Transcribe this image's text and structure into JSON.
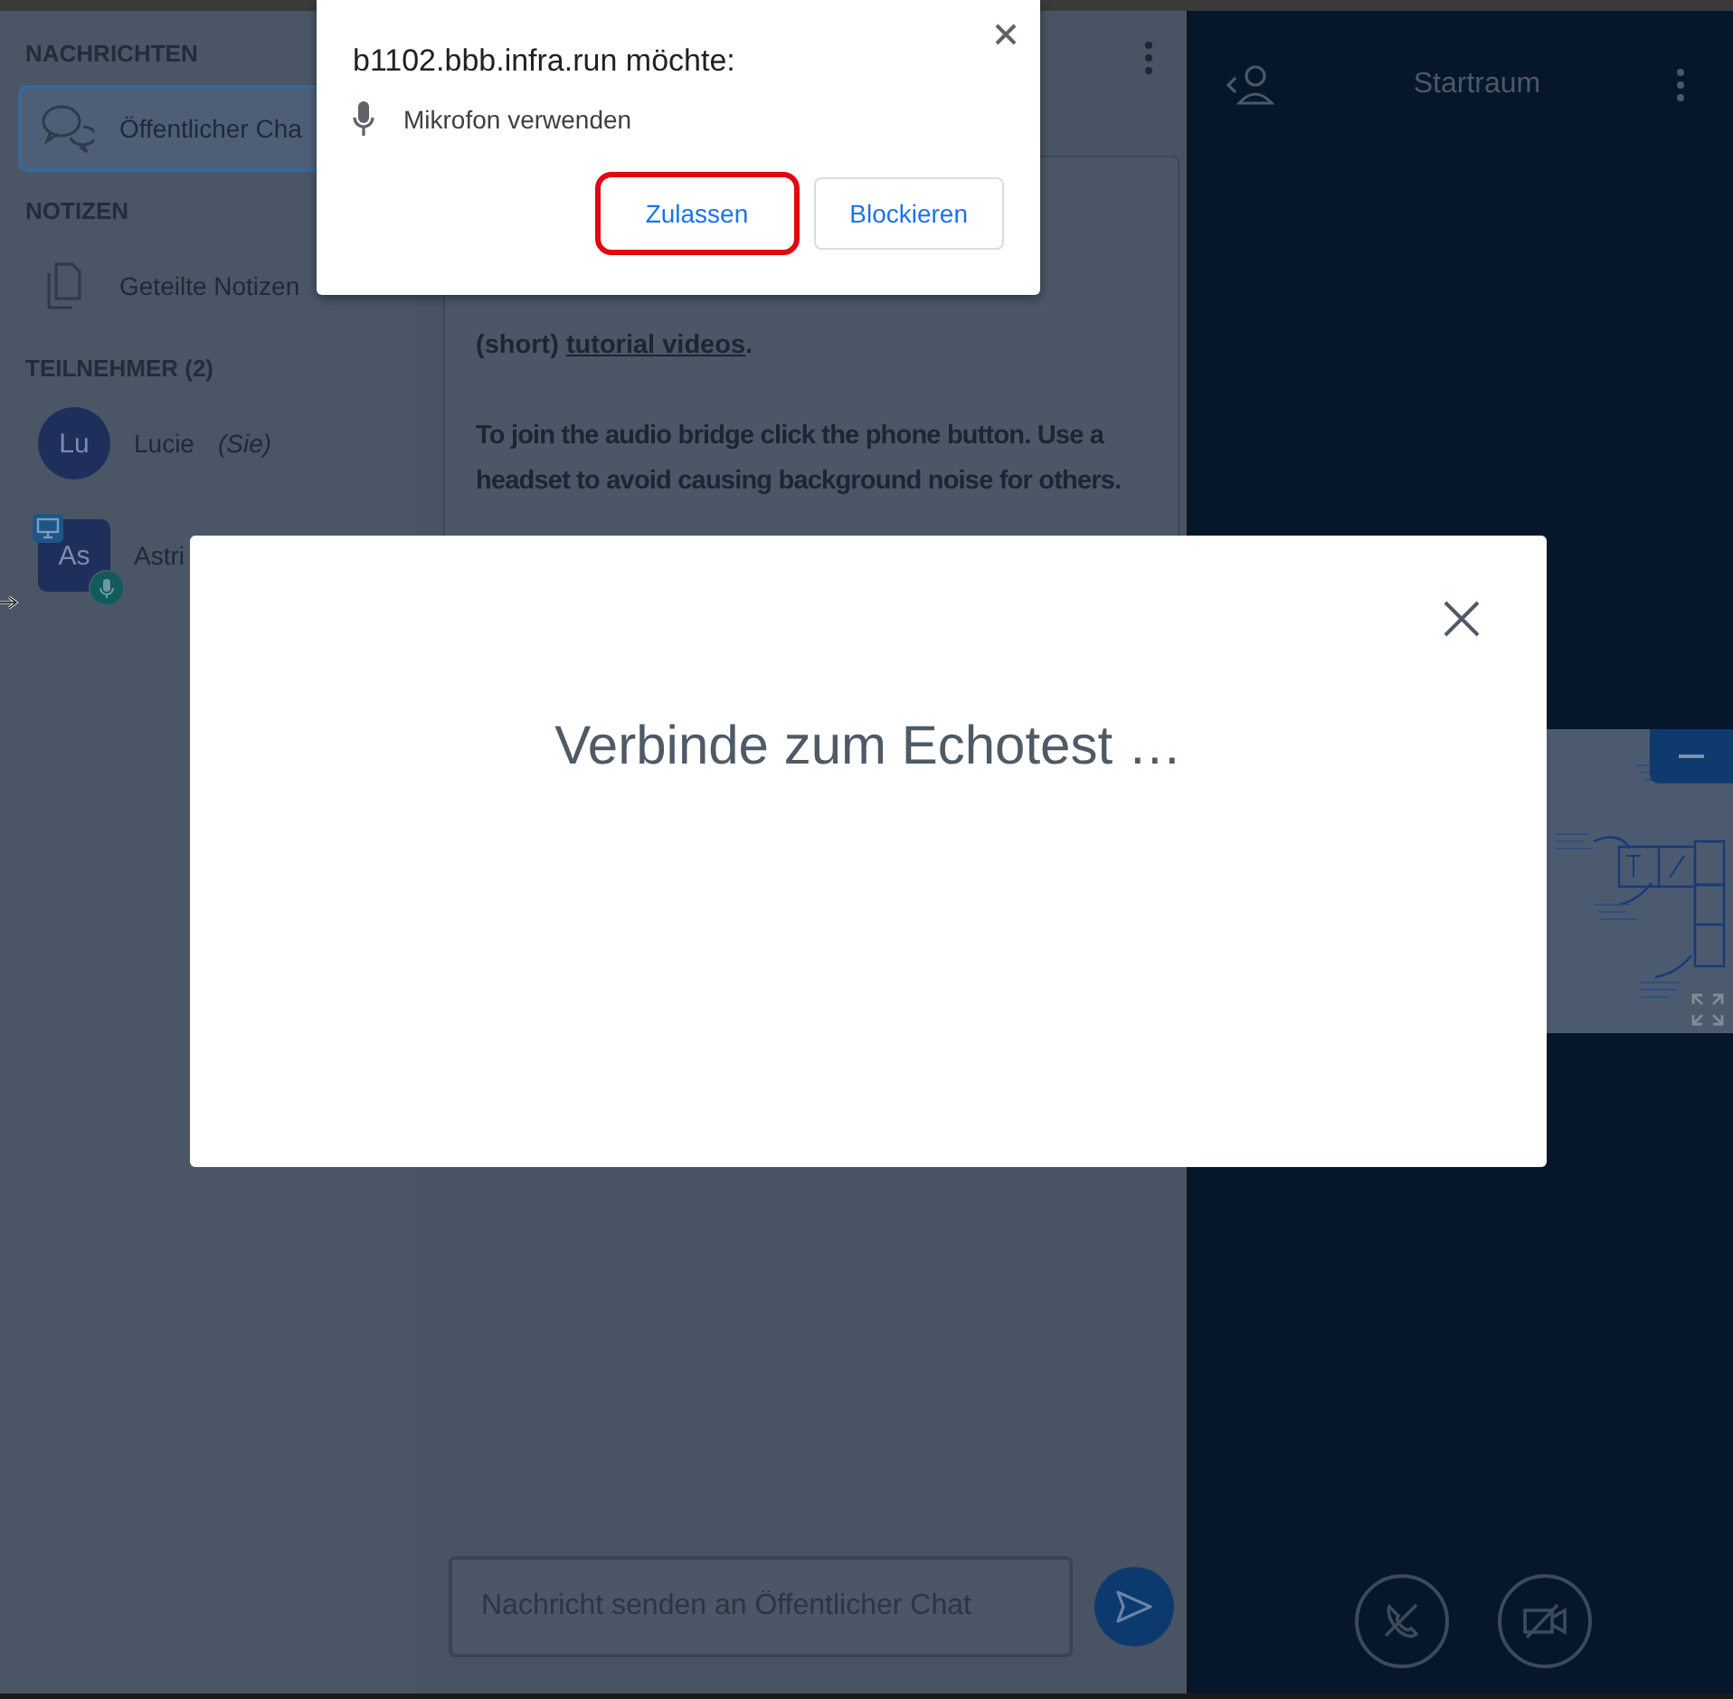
{
  "popup": {
    "origin": "b1102.bbb.infra.run möchte:",
    "permission": "Mikrofon verwenden",
    "buttons": [
      {
        "label": "Zulassen",
        "highlighted": true
      },
      {
        "label": "Blockieren",
        "highlighted": false
      }
    ]
  },
  "sidebar": {
    "sections": [
      {
        "title": "NACHRICHTEN",
        "items": [
          {
            "kind": "chat",
            "label": "Öffentlicher Cha",
            "selected": true
          }
        ]
      },
      {
        "title": "NOTIZEN",
        "items": [
          {
            "kind": "notes",
            "label": "Geteilte Notizen",
            "selected": false
          }
        ]
      }
    ],
    "participants": {
      "title": "TEILNEHMER (2)",
      "users": [
        {
          "initials": "Lu",
          "name": "Lucie",
          "note": "(Sie)",
          "moderator": false,
          "presenter": false,
          "microphone": false
        },
        {
          "initials": "As",
          "name": "Astri",
          "moderator": true,
          "presenter": true,
          "microphone": true
        }
      ]
    }
  },
  "chat": {
    "message": {
      "before": "(short) ",
      "link": "tutorial videos",
      "after": ".",
      "paragraph": "To join the audio bridge click the phone button. Use a headset to avoid causing background noise for others."
    },
    "input": {
      "placeholder": "Nachricht senden an Öffentlicher Chat"
    }
  },
  "room": {
    "title": "Startraum"
  },
  "modal": {
    "title": "Verbinde zum Echotest …"
  }
}
